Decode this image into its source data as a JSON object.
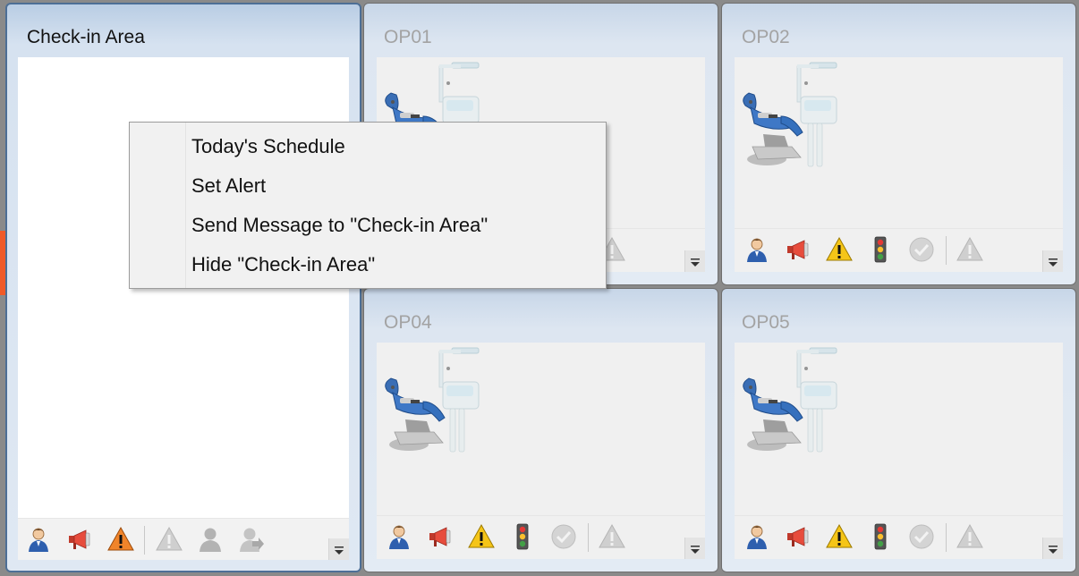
{
  "panels": {
    "checkin": {
      "title": "Check-in Area"
    },
    "op01": {
      "title": "OP01"
    },
    "op02": {
      "title": "OP02"
    },
    "op04": {
      "title": "OP04"
    },
    "op05": {
      "title": "OP05"
    }
  },
  "context_menu": {
    "items": [
      "Today's Schedule",
      "Set Alert",
      "Send Message to \"Check-in Area\"",
      "Hide \"Check-in Area\""
    ]
  },
  "icons": {
    "patient": "patient-icon",
    "megaphone": "megaphone-icon",
    "alert": "alert-icon",
    "traffic_light": "traffic-light-icon",
    "check": "check-circle-icon",
    "dropdown": "dropdown-icon"
  },
  "colors": {
    "accent": "#f05a28",
    "panel_header": "#c7d6e8",
    "active_border": "#4d6f96"
  }
}
